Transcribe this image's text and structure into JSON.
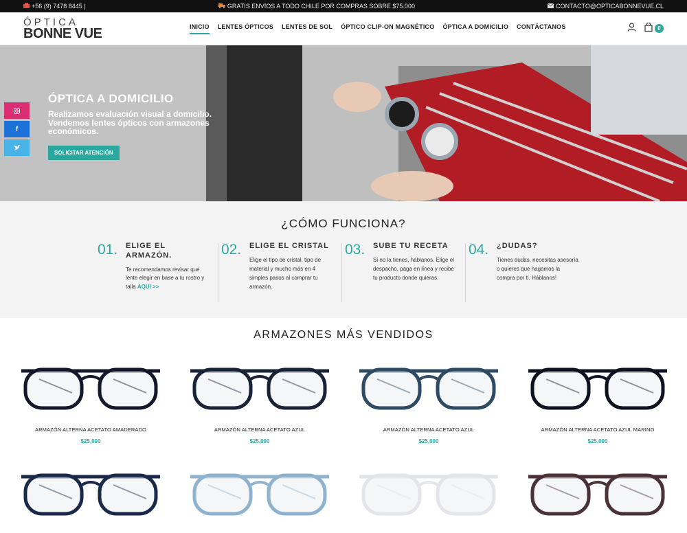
{
  "topbar": {
    "phone": "+56 (9) 7478 8445 |",
    "promo": "GRATIS ENVÍOS A TODO CHILE POR COMPRAS SOBRE $75.000",
    "email": "CONTACTO@OPTICABONNEVUE.CL"
  },
  "logo": {
    "line1": "ÓPTICA",
    "line2": "BONNE VUE"
  },
  "nav": [
    "INICIO",
    "LENTES ÓPTICOS",
    "LENTES DE SOL",
    "ÓPTICO CLIP-ON MAGNÉTICO",
    "ÓPTICA A DOMICILIO",
    "CONTÁCTANOS"
  ],
  "cart": {
    "count": "0"
  },
  "hero": {
    "title": "ÓPTICA A DOMICILIO",
    "subtitle": "Realizamos evaluación visual a domicilio. Vendemos lentes ópticos con armazones económicos.",
    "button": "SOLICITAR ATENCIÓN"
  },
  "how": {
    "title": "¿CÓMO FUNCIONA?",
    "steps": [
      {
        "num": "01.",
        "title": "ELIGE EL ARMAZÓN.",
        "text": "Te recomendamos revisar que lente elegir en base a tu rostro y talla",
        "link": "AQUI >>"
      },
      {
        "num": "02.",
        "title": "ELIGE EL CRISTAL",
        "text": "Elige el tipo de cristal, tipo de material y mucho más en 4 simples pasos al comprar tu armazón.",
        "link": ""
      },
      {
        "num": "03.",
        "title": "SUBE TU RECETA",
        "text": "Si no la tienes, háblanos. Elige el despacho, paga en línea y recibe tu producto donde quieras.",
        "link": ""
      },
      {
        "num": "04.",
        "title": "¿DUDAS?",
        "text": "Tienes dudas, necesitas asesoría o quieres que hagamos la compra por ti. Háblanos!",
        "link": ""
      }
    ]
  },
  "products": {
    "title": "ARMAZONES MÁS VENDIDOS",
    "items": [
      {
        "name": "ARMAZÓN ALTERNA ACETATO AMADERADO",
        "price": "$25,000",
        "frame_color": "#14182a"
      },
      {
        "name": "ARMAZÓN ALTERNA ACETATO AZUL",
        "price": "$25,000",
        "frame_color": "#1a2236"
      },
      {
        "name": "ARMAZÓN ALTERNA ACETATO AZUL",
        "price": "$25,000",
        "frame_color": "#2f4a63"
      },
      {
        "name": "ARMAZÓN ALTERNA ACETATO AZUL MARINO",
        "price": "$25,000",
        "frame_color": "#0f1320"
      },
      {
        "name": "",
        "price": "",
        "frame_color": "#1b2a4a"
      },
      {
        "name": "",
        "price": "",
        "frame_color": "#8fb3cf"
      },
      {
        "name": "",
        "price": "",
        "frame_color": "#e3e5ea"
      },
      {
        "name": "",
        "price": "",
        "frame_color": "#4a3238"
      }
    ]
  },
  "colors": {
    "accent": "#2ba7a0",
    "topbar": "#111111",
    "section_bg": "#f3f3f3"
  }
}
